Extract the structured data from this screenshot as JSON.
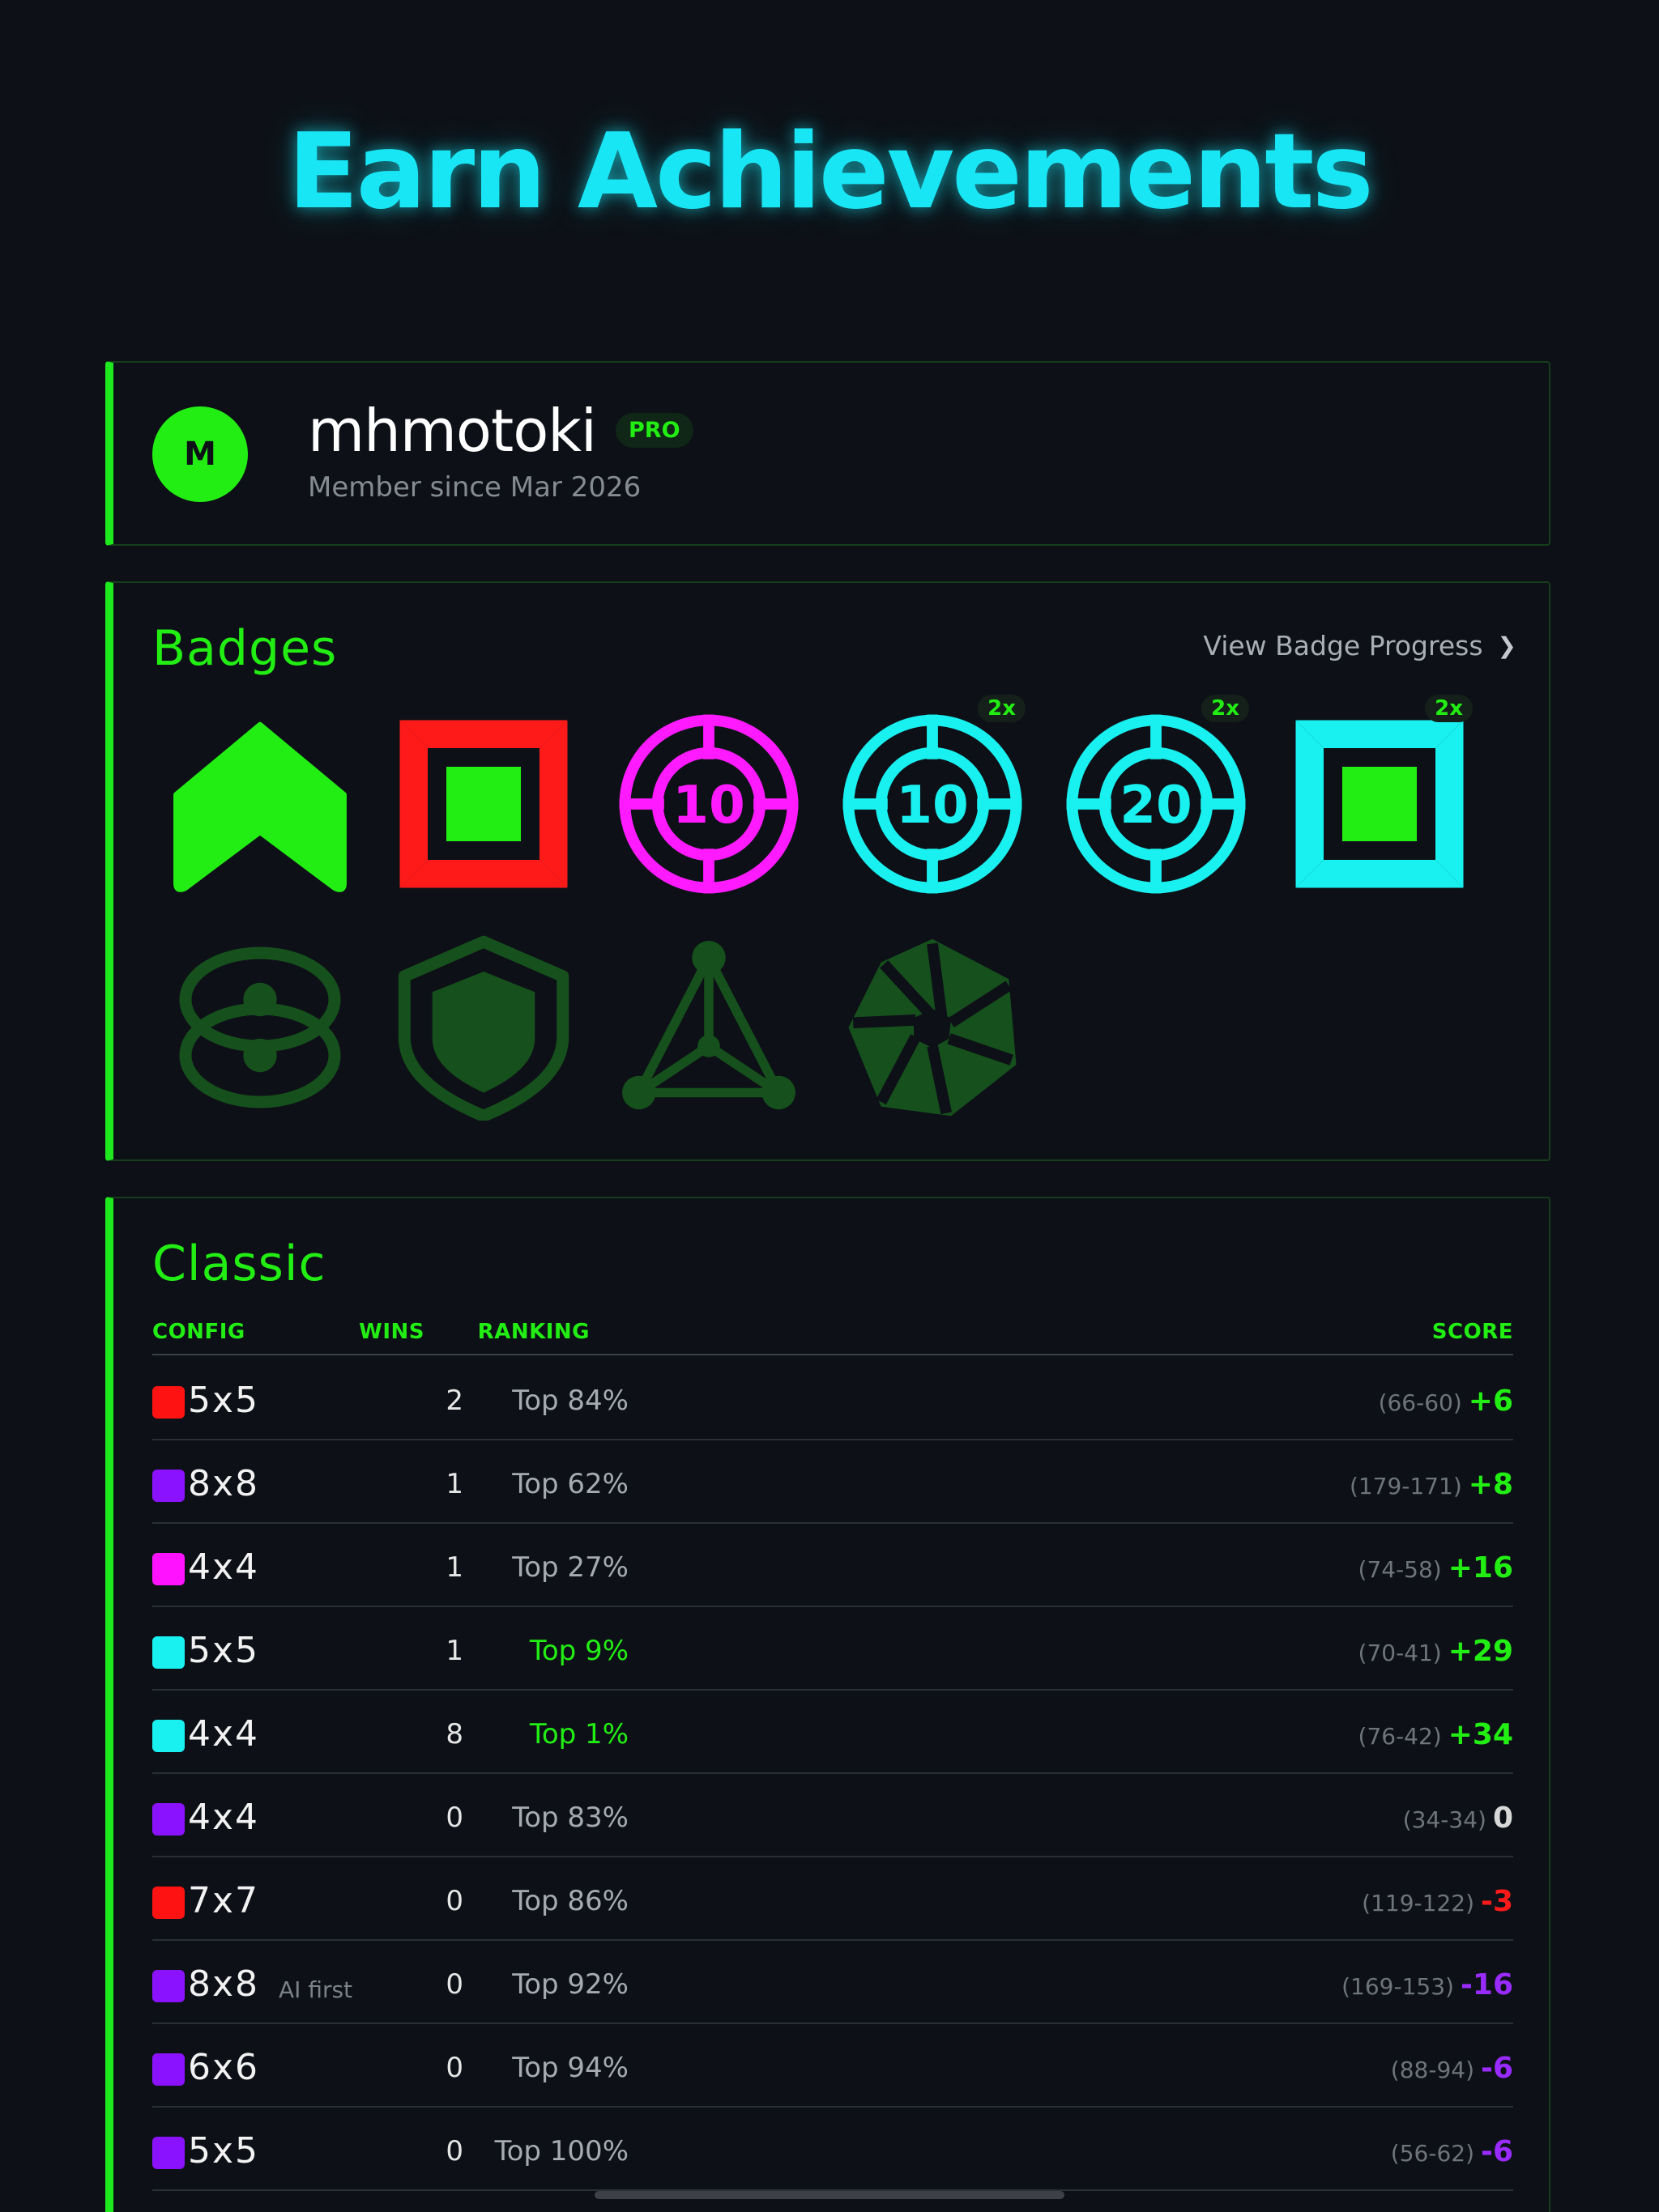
{
  "hero": {
    "title": "Earn Achievements"
  },
  "profile": {
    "avatar_initial": "M",
    "username": "mhmotoki",
    "tier": "PRO",
    "member_since": "Member since Mar 2026"
  },
  "badges": {
    "title": "Badges",
    "progress_link": "View Badge Progress",
    "progress_chevron": "❯",
    "items": [
      {
        "icon": "chevron-up-badge-icon",
        "color": "#22ee14",
        "earned": true
      },
      {
        "icon": "square-frame-badge-icon",
        "color": "#ff1a1a",
        "earned": true
      },
      {
        "icon": "target-badge-icon",
        "color": "#ff1aff",
        "label": "10",
        "earned": true
      },
      {
        "icon": "target-badge-icon",
        "color": "#19f0f0",
        "label": "10",
        "multiplier": "2x",
        "earned": true
      },
      {
        "icon": "target-badge-icon",
        "color": "#19f0f0",
        "label": "20",
        "multiplier": "2x",
        "earned": true
      },
      {
        "icon": "square-frame-badge-icon",
        "color": "#19f0f0",
        "multiplier": "2x",
        "earned": true
      },
      {
        "icon": "linked-rings-badge-icon",
        "color": "#16501c",
        "earned": false
      },
      {
        "icon": "shield-badge-icon",
        "color": "#16501c",
        "earned": false
      },
      {
        "icon": "network-triangle-badge-icon",
        "color": "#16501c",
        "earned": false
      },
      {
        "icon": "aperture-badge-icon",
        "color": "#16501c",
        "earned": false
      }
    ]
  },
  "classic": {
    "title": "Classic",
    "columns": {
      "config": "CONFIG",
      "wins": "WINS",
      "ranking": "RANKING",
      "score": "SCORE"
    },
    "rows": [
      {
        "color": "#ff1212",
        "config": "5x5",
        "note": "",
        "wins": "2",
        "ranking": "Top 84%",
        "rank_good": false,
        "range": "(66-60)",
        "delta": "+6",
        "delta_color": "#22ee14"
      },
      {
        "color": "#8a12ff",
        "config": "8x8",
        "note": "",
        "wins": "1",
        "ranking": "Top 62%",
        "rank_good": false,
        "range": "(179-171)",
        "delta": "+8",
        "delta_color": "#22ee14"
      },
      {
        "color": "#ff12ff",
        "config": "4x4",
        "note": "",
        "wins": "1",
        "ranking": "Top 27%",
        "rank_good": false,
        "range": "(74-58)",
        "delta": "+16",
        "delta_color": "#22ee14"
      },
      {
        "color": "#19f0f0",
        "config": "5x5",
        "note": "",
        "wins": "1",
        "ranking": "Top 9%",
        "rank_good": true,
        "range": "(70-41)",
        "delta": "+29",
        "delta_color": "#22ee14"
      },
      {
        "color": "#19f0f0",
        "config": "4x4",
        "note": "",
        "wins": "8",
        "ranking": "Top 1%",
        "rank_good": true,
        "range": "(76-42)",
        "delta": "+34",
        "delta_color": "#22ee14"
      },
      {
        "color": "#8a12ff",
        "config": "4x4",
        "note": "",
        "wins": "0",
        "ranking": "Top 83%",
        "rank_good": false,
        "range": "(34-34)",
        "delta": "0",
        "delta_color": "#d8d8d8"
      },
      {
        "color": "#ff1212",
        "config": "7x7",
        "note": "",
        "wins": "0",
        "ranking": "Top 86%",
        "rank_good": false,
        "range": "(119-122)",
        "delta": "-3",
        "delta_color": "#ff1a1a"
      },
      {
        "color": "#8a12ff",
        "config": "8x8",
        "note": "AI first",
        "wins": "0",
        "ranking": "Top 92%",
        "rank_good": false,
        "range": "(169-153)",
        "delta": "-16",
        "delta_color": "#9a2bff"
      },
      {
        "color": "#8a12ff",
        "config": "6x6",
        "note": "",
        "wins": "0",
        "ranking": "Top 94%",
        "rank_good": false,
        "range": "(88-94)",
        "delta": "-6",
        "delta_color": "#9a2bff"
      },
      {
        "color": "#8a12ff",
        "config": "5x5",
        "note": "",
        "wins": "0",
        "ranking": "Top 100%",
        "rank_good": false,
        "range": "(56-62)",
        "delta": "-6",
        "delta_color": "#9a2bff"
      }
    ]
  }
}
